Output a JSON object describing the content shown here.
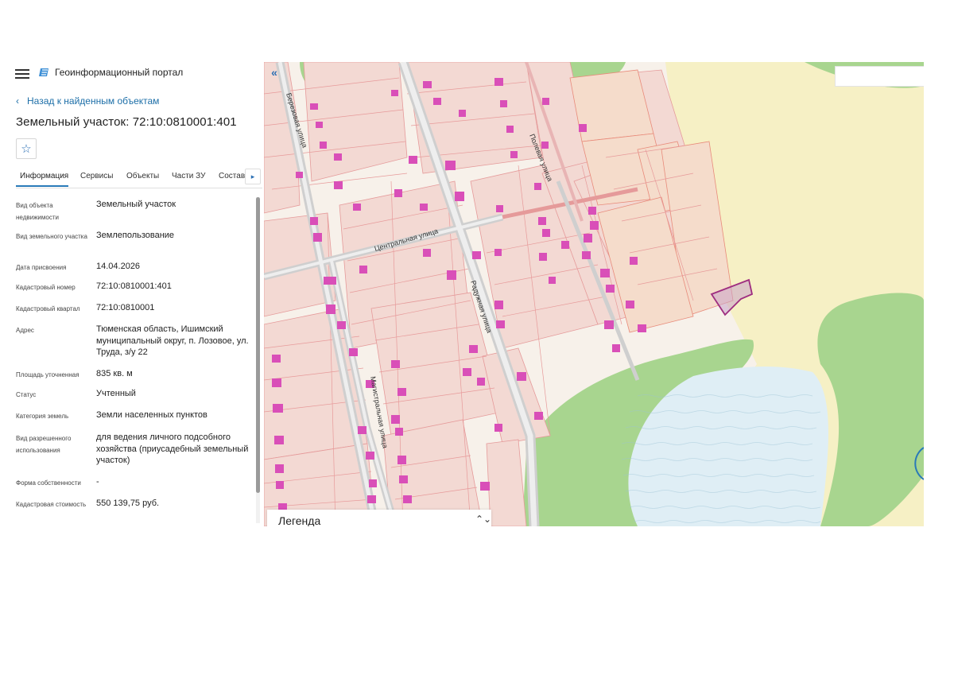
{
  "header": {
    "menu_icon": "hamburger-menu-icon",
    "logo_icon": "portal-logo-icon",
    "title": "Геоинформационный портал"
  },
  "nav": {
    "back_label": "Назад к найденным объектам"
  },
  "object": {
    "title": "Земельный участок: 72:10:0810001:401",
    "favorite_icon": "star-icon"
  },
  "tabs": [
    {
      "label": "Информация",
      "active": true
    },
    {
      "label": "Сервисы"
    },
    {
      "label": "Объекты"
    },
    {
      "label": "Части ЗУ"
    },
    {
      "label": "Состав"
    }
  ],
  "properties": [
    {
      "label": "Вид объекта недвижимости",
      "value": "Земельный участок"
    },
    {
      "label": "Вид земельного участка",
      "value": "Землепользование"
    },
    {
      "label": "Дата присвоения",
      "value": "14.04.2026"
    },
    {
      "label": "Кадастровый номер",
      "value": "72:10:0810001:401"
    },
    {
      "label": "Кадастровый квартал",
      "value": "72:10:0810001"
    },
    {
      "label": "Адрес",
      "value": "Тюменская область, Ишимский муниципальный округ, п. Лозовое, ул. Труда, з/у 22"
    },
    {
      "label": "Площадь уточненная",
      "value": "835 кв. м"
    },
    {
      "label": "Статус",
      "value": "Учтенный"
    },
    {
      "label": "Категория земель",
      "value": "Земли населенных пунктов"
    },
    {
      "label": "Вид разрешенного использования",
      "value": "для ведения личного подсобного хозяйства (приусадебный земельный участок)"
    },
    {
      "label": "Форма собственности",
      "value": "-"
    },
    {
      "label": "Кадастровая стоимость",
      "value": "550 139,75 руб."
    }
  ],
  "map": {
    "collapse_icon": "double-chevron-left-icon",
    "legend_label": "Легенда",
    "legend_icon": "expand-updown-icon",
    "streets": [
      "Березовая улица",
      "Центральная улица",
      "Радужная улица",
      "Полевая улица",
      "Магистральная улица"
    ],
    "colors": {
      "parcel": "#f3d9d3",
      "parcel_border": "#e07c7c",
      "building": "#d94fb8",
      "forest": "#a8d58f",
      "field": "#f6f0c5",
      "water": "#dfeef5",
      "road": "#d3d3d3",
      "selected": "#b03a8c"
    }
  }
}
